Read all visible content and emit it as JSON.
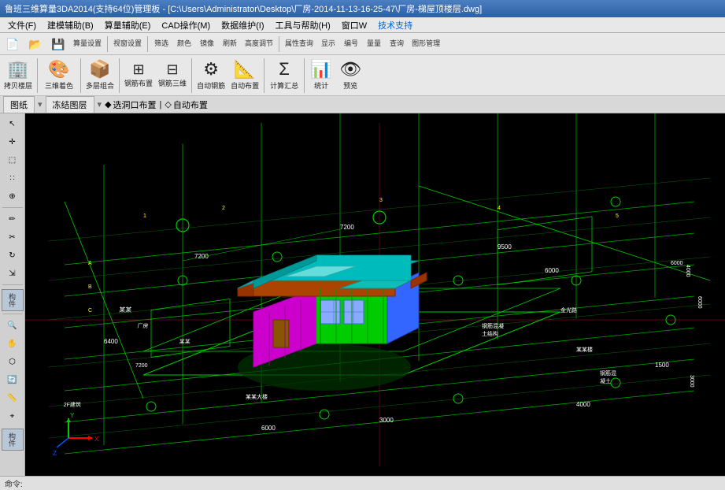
{
  "title": {
    "text": "鲁班三维算量3DA2014(支持64位)管理板 - [C:\\Users\\Administrator\\Desktop\\厂房-2014-11-13-16-25-47\\厂房-梯屋顶楼层.dwg]"
  },
  "menu": {
    "items": [
      "文件(F)",
      "建模辅助(B)",
      "算量辅助(E)",
      "CAD操作(M)",
      "数据维护(I)",
      "工具与帮助(H)",
      "窗口W",
      "技术支持"
    ]
  },
  "toolbar1": {
    "buttons": [
      "新建",
      "打开",
      "保存",
      "算量设置",
      "视窗设置",
      "筛选",
      "颜色",
      "镜像",
      "刷新",
      "高度调调",
      "属性查询",
      "显示",
      "编号号",
      "量量",
      "查询",
      "图形管理"
    ]
  },
  "toolbar2": {
    "sections": [
      {
        "label": "拷贝楼层",
        "icon": "🏢"
      },
      {
        "label": "三维着色",
        "icon": "🎨"
      },
      {
        "label": "多层组合",
        "icon": "📦"
      },
      {
        "label": "钢筋布置",
        "icon": "🔧"
      },
      {
        "label": "钢筋三维",
        "icon": "🔩"
      },
      {
        "label": "自动钢筋",
        "icon": "⚙"
      },
      {
        "label": "自动布置",
        "icon": "📐"
      },
      {
        "label": "计算汇总",
        "icon": "📊"
      },
      {
        "label": "统计",
        "icon": "📈"
      },
      {
        "label": "预览",
        "icon": "👁"
      }
    ]
  },
  "tabs": {
    "items": [
      "图纸",
      "冻结图层",
      "选洞口布置",
      "自动布置"
    ]
  },
  "sidebar": {
    "sections": [
      "构件",
      "构件"
    ]
  },
  "cad": {
    "building": {
      "roof_color": "#00cccc",
      "wall_colors": [
        "#00cc00",
        "#cc00cc",
        "#0066ff"
      ],
      "beam_color": "#cc4400"
    }
  },
  "statusbar": {
    "text": ""
  }
}
